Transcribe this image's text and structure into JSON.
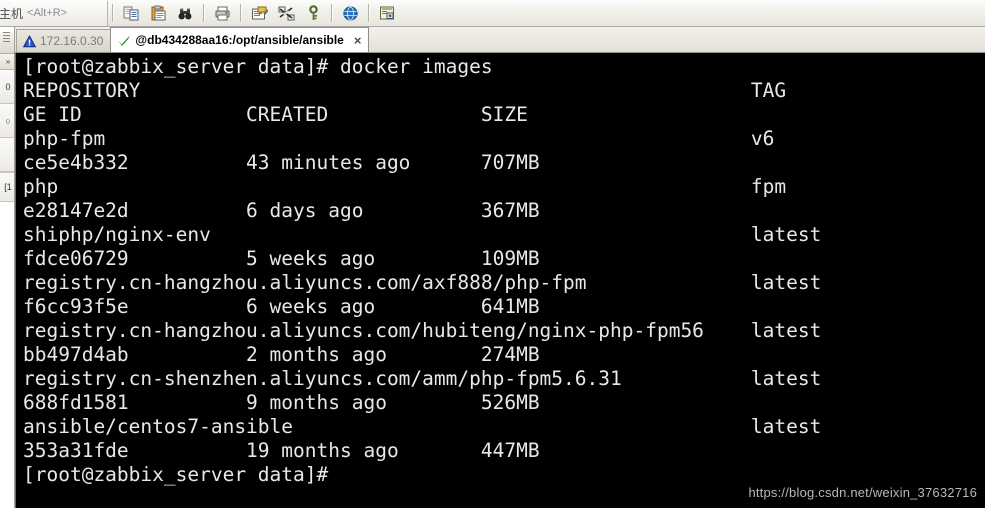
{
  "toolbar": {
    "host_label": "主机",
    "host_shortcut": "<Alt+R>",
    "buttons": [
      {
        "name": "copy-paste-icon",
        "title": "Copy and Paste"
      },
      {
        "name": "paste-icon",
        "title": "Paste"
      },
      {
        "name": "find-binoculars-icon",
        "title": "Find"
      },
      {
        "name": "print-icon",
        "title": "Print"
      },
      {
        "name": "log-session-icon",
        "title": "Log Session"
      },
      {
        "name": "transfer-files-icon",
        "title": "Transfer Files"
      },
      {
        "name": "key-icon",
        "title": "Key Manager"
      },
      {
        "name": "help-globe-icon",
        "title": "Help"
      },
      {
        "name": "window-layout-icon",
        "title": "Arrange Windows"
      }
    ]
  },
  "sidebar": {
    "collapse_glyph": "»",
    "items": [
      {
        "name": "session-manager",
        "label": "0"
      },
      {
        "name": "object-browser",
        "label": "○"
      },
      {
        "name": "file-panel",
        "label": ""
      },
      {
        "name": "command-history",
        "label": "[1"
      }
    ]
  },
  "tabs": [
    {
      "id": "tab-172-16-0-30",
      "label": "172.16.0.30",
      "icon": "warning-triangle-icon",
      "active": false,
      "closable": false
    },
    {
      "id": "tab-db434288aa16",
      "label": "@db434288aa16:/opt/ansible/ansible",
      "icon": "green-check-icon",
      "active": true,
      "closable": true,
      "close_glyph": "×"
    }
  ],
  "terminal": {
    "prompt": "[root@zabbix_server data]#",
    "command": "docker images",
    "colors": {
      "background": "#000000",
      "foreground": "#e8e8e8"
    },
    "lines": [
      "[root@zabbix_server data]# docker images",
      "REPOSITORY                                                    TAG",
      "GE ID              CREATED             SIZE",
      "php-fpm                                                       v6",
      "ce5e4b332          43 minutes ago      707MB",
      "php                                                           fpm",
      "e28147e2d          6 days ago          367MB",
      "shiphp/nginx-env                                              latest",
      "fdce06729          5 weeks ago         109MB",
      "registry.cn-hangzhou.aliyuncs.com/axf888/php-fpm              latest",
      "f6cc93f5e          6 weeks ago         641MB",
      "registry.cn-hangzhou.aliyuncs.com/hubiteng/nginx-php-fpm56    latest",
      "bb497d4ab          2 months ago        274MB",
      "registry.cn-shenzhen.aliyuncs.com/amm/php-fpm5.6.31           latest",
      "688fd1581          9 months ago        526MB",
      "ansible/centos7-ansible                                       latest",
      "353a31fde          19 months ago       447MB",
      "[root@zabbix_server data]#"
    ],
    "images_table": {
      "headers": [
        "REPOSITORY",
        "TAG",
        "IMAGE ID",
        "CREATED",
        "SIZE"
      ],
      "rows": [
        {
          "repository": "php-fpm",
          "tag": "v6",
          "image_id": "ce5e4b332",
          "created": "43 minutes ago",
          "size": "707MB"
        },
        {
          "repository": "php",
          "tag": "fpm",
          "image_id": "e28147e2d",
          "created": "6 days ago",
          "size": "367MB"
        },
        {
          "repository": "shiphp/nginx-env",
          "tag": "latest",
          "image_id": "fdce06729",
          "created": "5 weeks ago",
          "size": "109MB"
        },
        {
          "repository": "registry.cn-hangzhou.aliyuncs.com/axf888/php-fpm",
          "tag": "latest",
          "image_id": "f6cc93f5e",
          "created": "6 weeks ago",
          "size": "641MB"
        },
        {
          "repository": "registry.cn-hangzhou.aliyuncs.com/hubiteng/nginx-php-fpm56",
          "tag": "latest",
          "image_id": "bb497d4ab",
          "created": "2 months ago",
          "size": "274MB"
        },
        {
          "repository": "registry.cn-shenzhen.aliyuncs.com/amm/php-fpm5.6.31",
          "tag": "latest",
          "image_id": "688fd1581",
          "created": "9 months ago",
          "size": "526MB"
        },
        {
          "repository": "ansible/centos7-ansible",
          "tag": "latest",
          "image_id": "353a31fde",
          "created": "19 months ago",
          "size": "447MB"
        }
      ]
    }
  },
  "watermark": "https://blog.csdn.net/weixin_37632716"
}
